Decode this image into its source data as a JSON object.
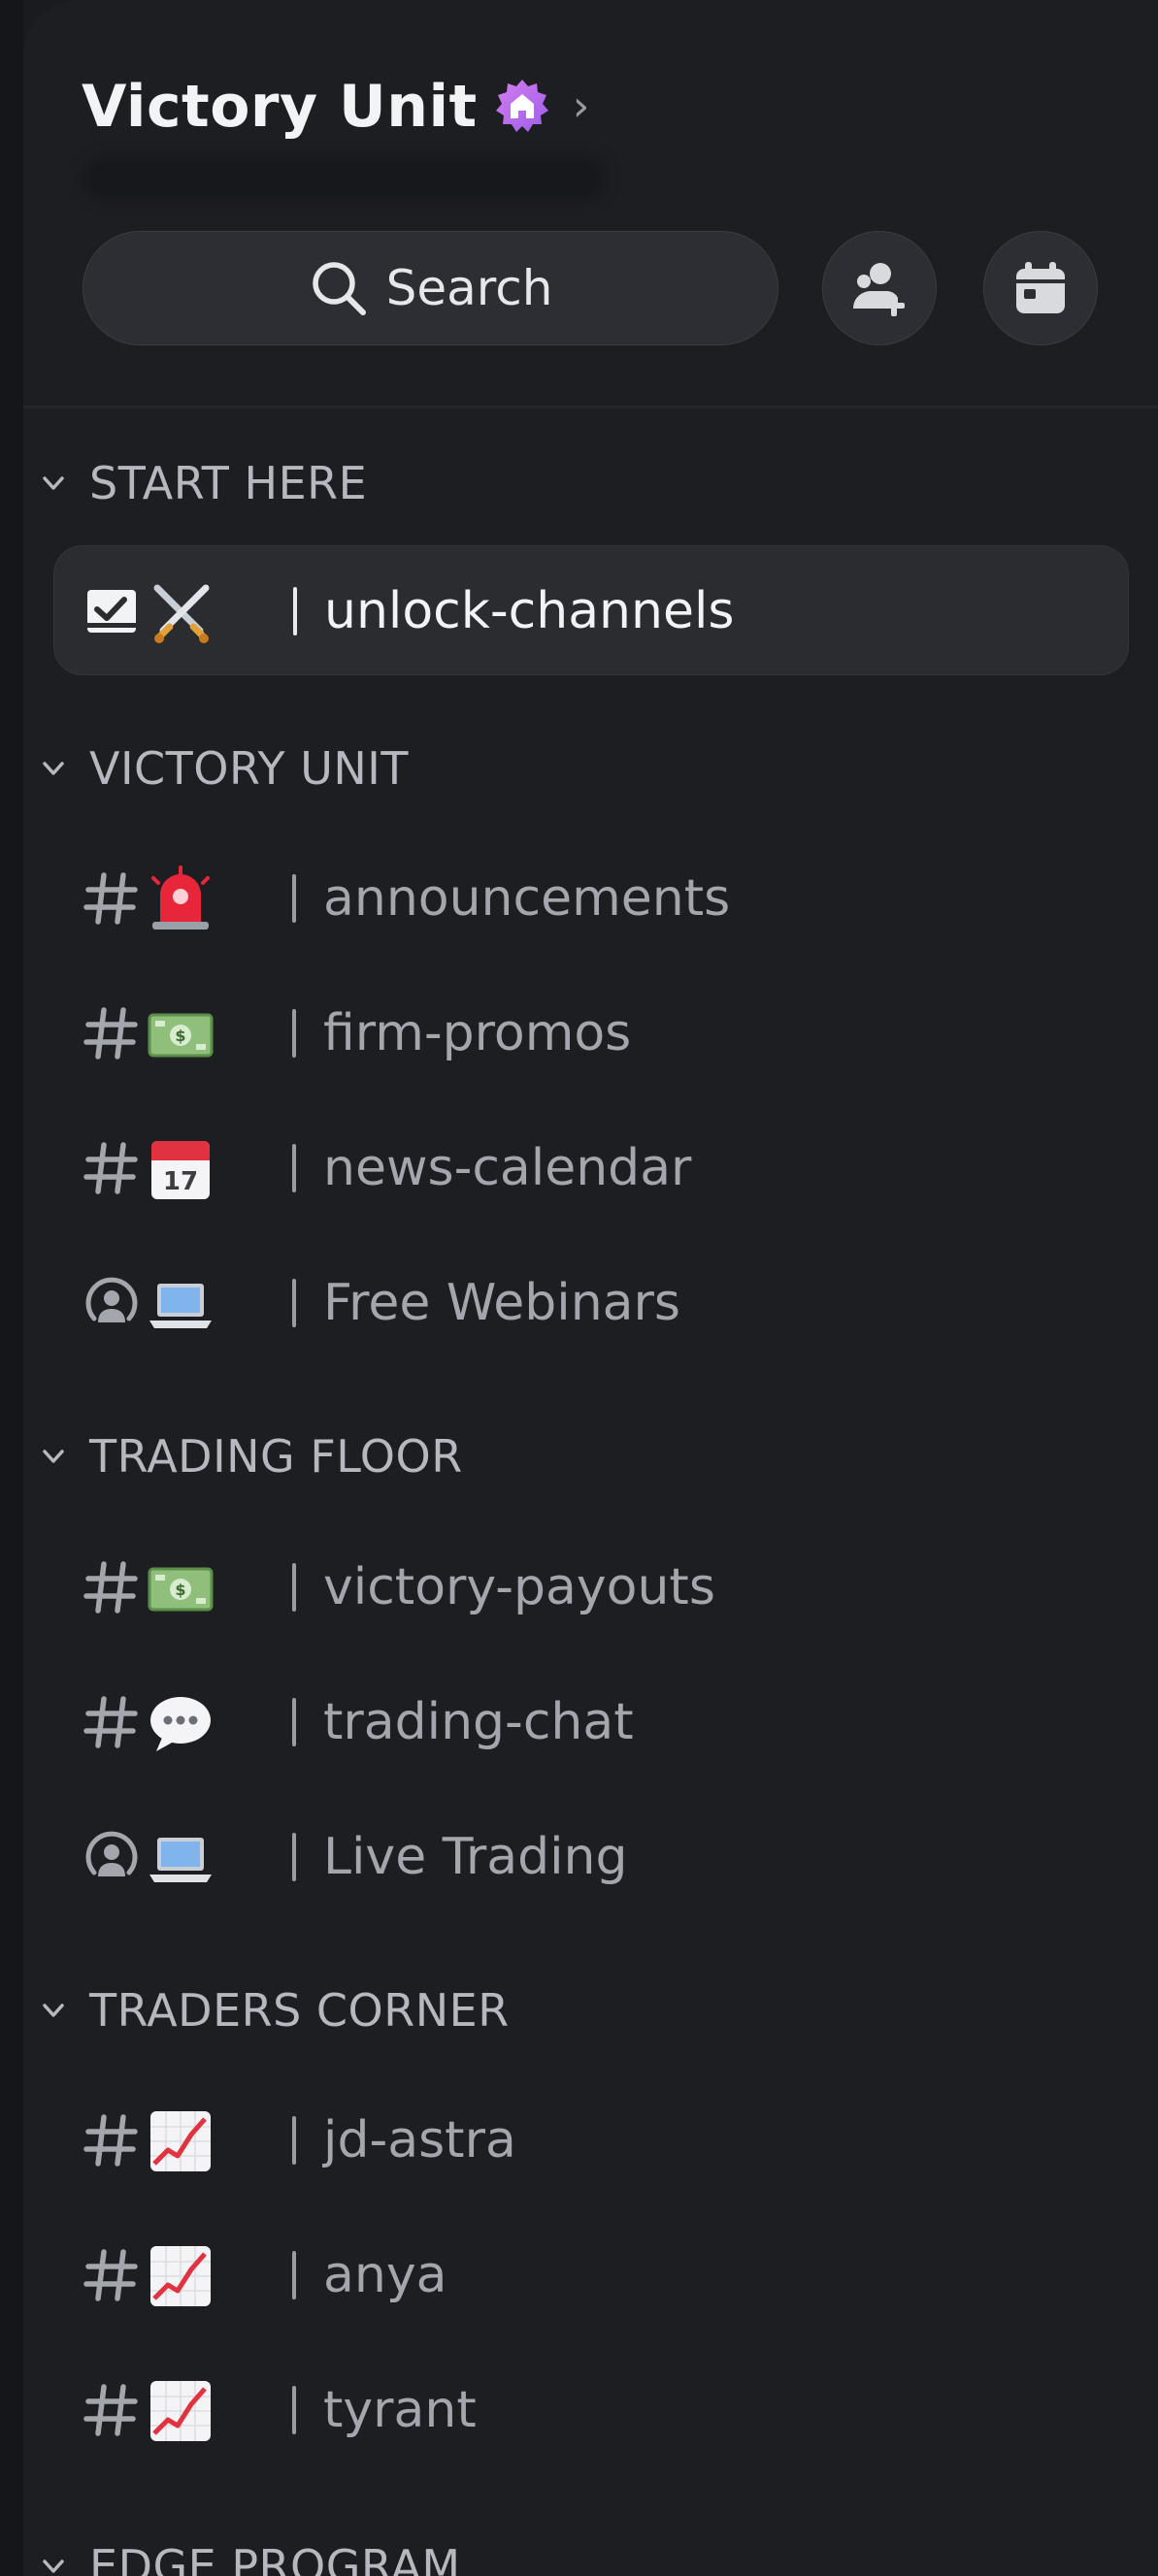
{
  "server": {
    "name": "Victory Unit",
    "badge_icon": "boost-home-badge-icon"
  },
  "search": {
    "label": "Search"
  },
  "actions": {
    "invite_icon": "invite-members-icon",
    "events_icon": "calendar-icon"
  },
  "categories": [
    {
      "label": "START HERE",
      "channels": [
        {
          "type": "rules",
          "emoji": "crossed-swords",
          "name": "unlock-channels",
          "active": true
        }
      ]
    },
    {
      "label": "VICTORY UNIT",
      "channels": [
        {
          "type": "text",
          "emoji": "rotating-light",
          "name": "announcements"
        },
        {
          "type": "text",
          "emoji": "money",
          "name": "firm-promos"
        },
        {
          "type": "text",
          "emoji": "calendar",
          "name": "news-calendar"
        },
        {
          "type": "stage",
          "emoji": "laptop",
          "name": "Free Webinars"
        }
      ]
    },
    {
      "label": "TRADING FLOOR",
      "channels": [
        {
          "type": "text",
          "emoji": "money",
          "name": "victory-payouts"
        },
        {
          "type": "text",
          "emoji": "speech-balloon",
          "name": "trading-chat"
        },
        {
          "type": "stage",
          "emoji": "laptop",
          "name": "Live Trading"
        }
      ]
    },
    {
      "label": "TRADERS CORNER",
      "channels": [
        {
          "type": "text",
          "emoji": "chart-increasing",
          "name": "jd-astra"
        },
        {
          "type": "text",
          "emoji": "chart-increasing",
          "name": "anya"
        },
        {
          "type": "text",
          "emoji": "chart-increasing",
          "name": "tyrant"
        }
      ]
    },
    {
      "label": "EDGE PROGRAM",
      "channels": []
    }
  ]
}
